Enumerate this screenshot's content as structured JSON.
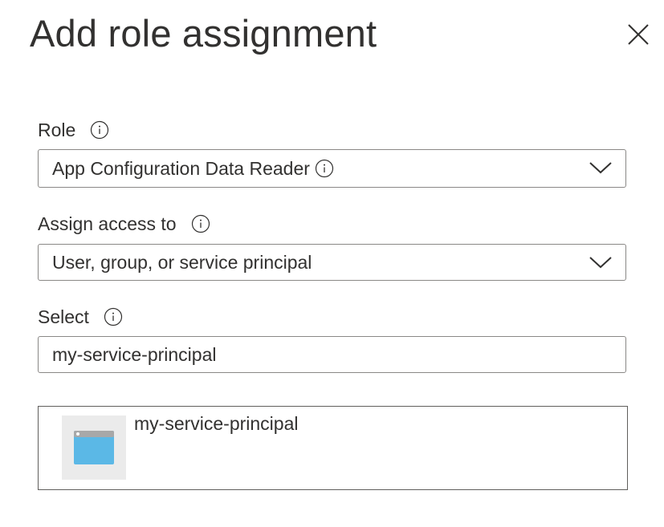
{
  "header": {
    "title": "Add role assignment",
    "close_icon": "close-icon"
  },
  "role": {
    "label": "Role",
    "selected": "App Configuration Data Reader",
    "info_icon": "info-icon",
    "chevron_icon": "chevron-down-icon"
  },
  "assign_access": {
    "label": "Assign access to",
    "selected": "User, group, or service principal",
    "info_icon": "info-icon",
    "chevron_icon": "chevron-down-icon"
  },
  "select": {
    "label": "Select",
    "value": "my-service-principal",
    "info_icon": "info-icon"
  },
  "results": [
    {
      "name": "my-service-principal",
      "icon": "application-icon"
    }
  ],
  "colors": {
    "text": "#323130",
    "border": "#8a8886",
    "app_icon_blue": "#5bb8e6"
  }
}
